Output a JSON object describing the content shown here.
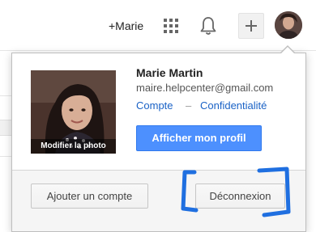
{
  "header": {
    "plus_user_label": "+Marie",
    "apps_icon": "apps-grid-icon",
    "notifications_icon": "bell-icon",
    "share_icon": "plus-icon",
    "avatar": "user-avatar"
  },
  "account_card": {
    "photo_caption": "Modifier la photo",
    "name": "Marie Martin",
    "email": "maire.helpcenter@gmail.com",
    "account_link": "Compte",
    "separator": "–",
    "privacy_link": "Confidentialité",
    "profile_button": "Afficher mon profil"
  },
  "footer": {
    "add_account_button": "Ajouter un compte",
    "logout_button": "Déconnexion"
  },
  "colors": {
    "primary_button": "#4d90fe",
    "link": "#1a62c6",
    "annotation": "#1f6fe0"
  }
}
